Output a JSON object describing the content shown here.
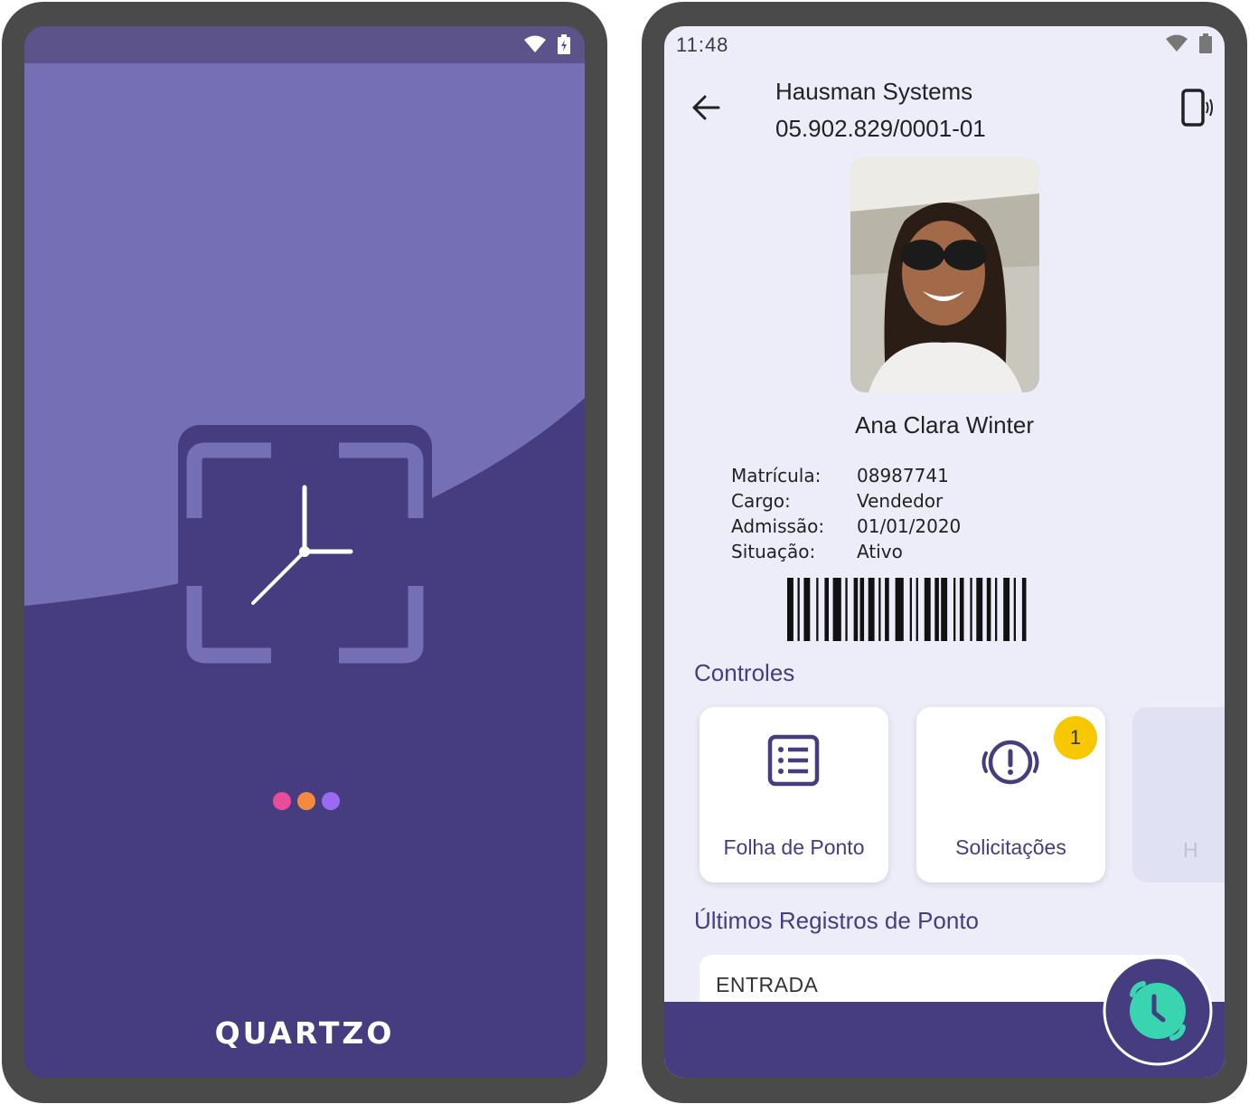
{
  "splash": {
    "brand": "QUARTZO",
    "colors": {
      "bg": "#453d7f",
      "wave": "#7570b5",
      "dot1": "#e84c9a",
      "dot2": "#f58a3d",
      "dot3": "#9a6af2"
    },
    "status_icons": [
      "wifi-icon",
      "battery-charging-icon"
    ]
  },
  "profile": {
    "time": "11:48",
    "company_name": "Hausman Systems",
    "company_cnpj": "05.902.829/0001-01",
    "employee_name": "Ana Clara Winter",
    "info": [
      {
        "label": "Matrícula:",
        "value": "08987741"
      },
      {
        "label": "Cargo:",
        "value": "Vendedor"
      },
      {
        "label": "Admissão:",
        "value": "01/01/2020"
      },
      {
        "label": "Situação:",
        "value": "Ativo"
      }
    ],
    "controls_title": "Controles",
    "cards": [
      {
        "label": "Folha de Ponto",
        "icon": "list-icon"
      },
      {
        "label": "Solicitações",
        "icon": "alert-clock-icon",
        "badge": "1"
      },
      {
        "label": "H",
        "icon": ""
      }
    ],
    "records_title": "Últimos Registros de Ponto",
    "record_label": "ENTRADA",
    "fab_icon": "alarm-clock-icon",
    "colors": {
      "bg": "#ededfa",
      "accent": "#453d7f",
      "badge": "#f7c800",
      "fab": "#39d4b0"
    }
  }
}
